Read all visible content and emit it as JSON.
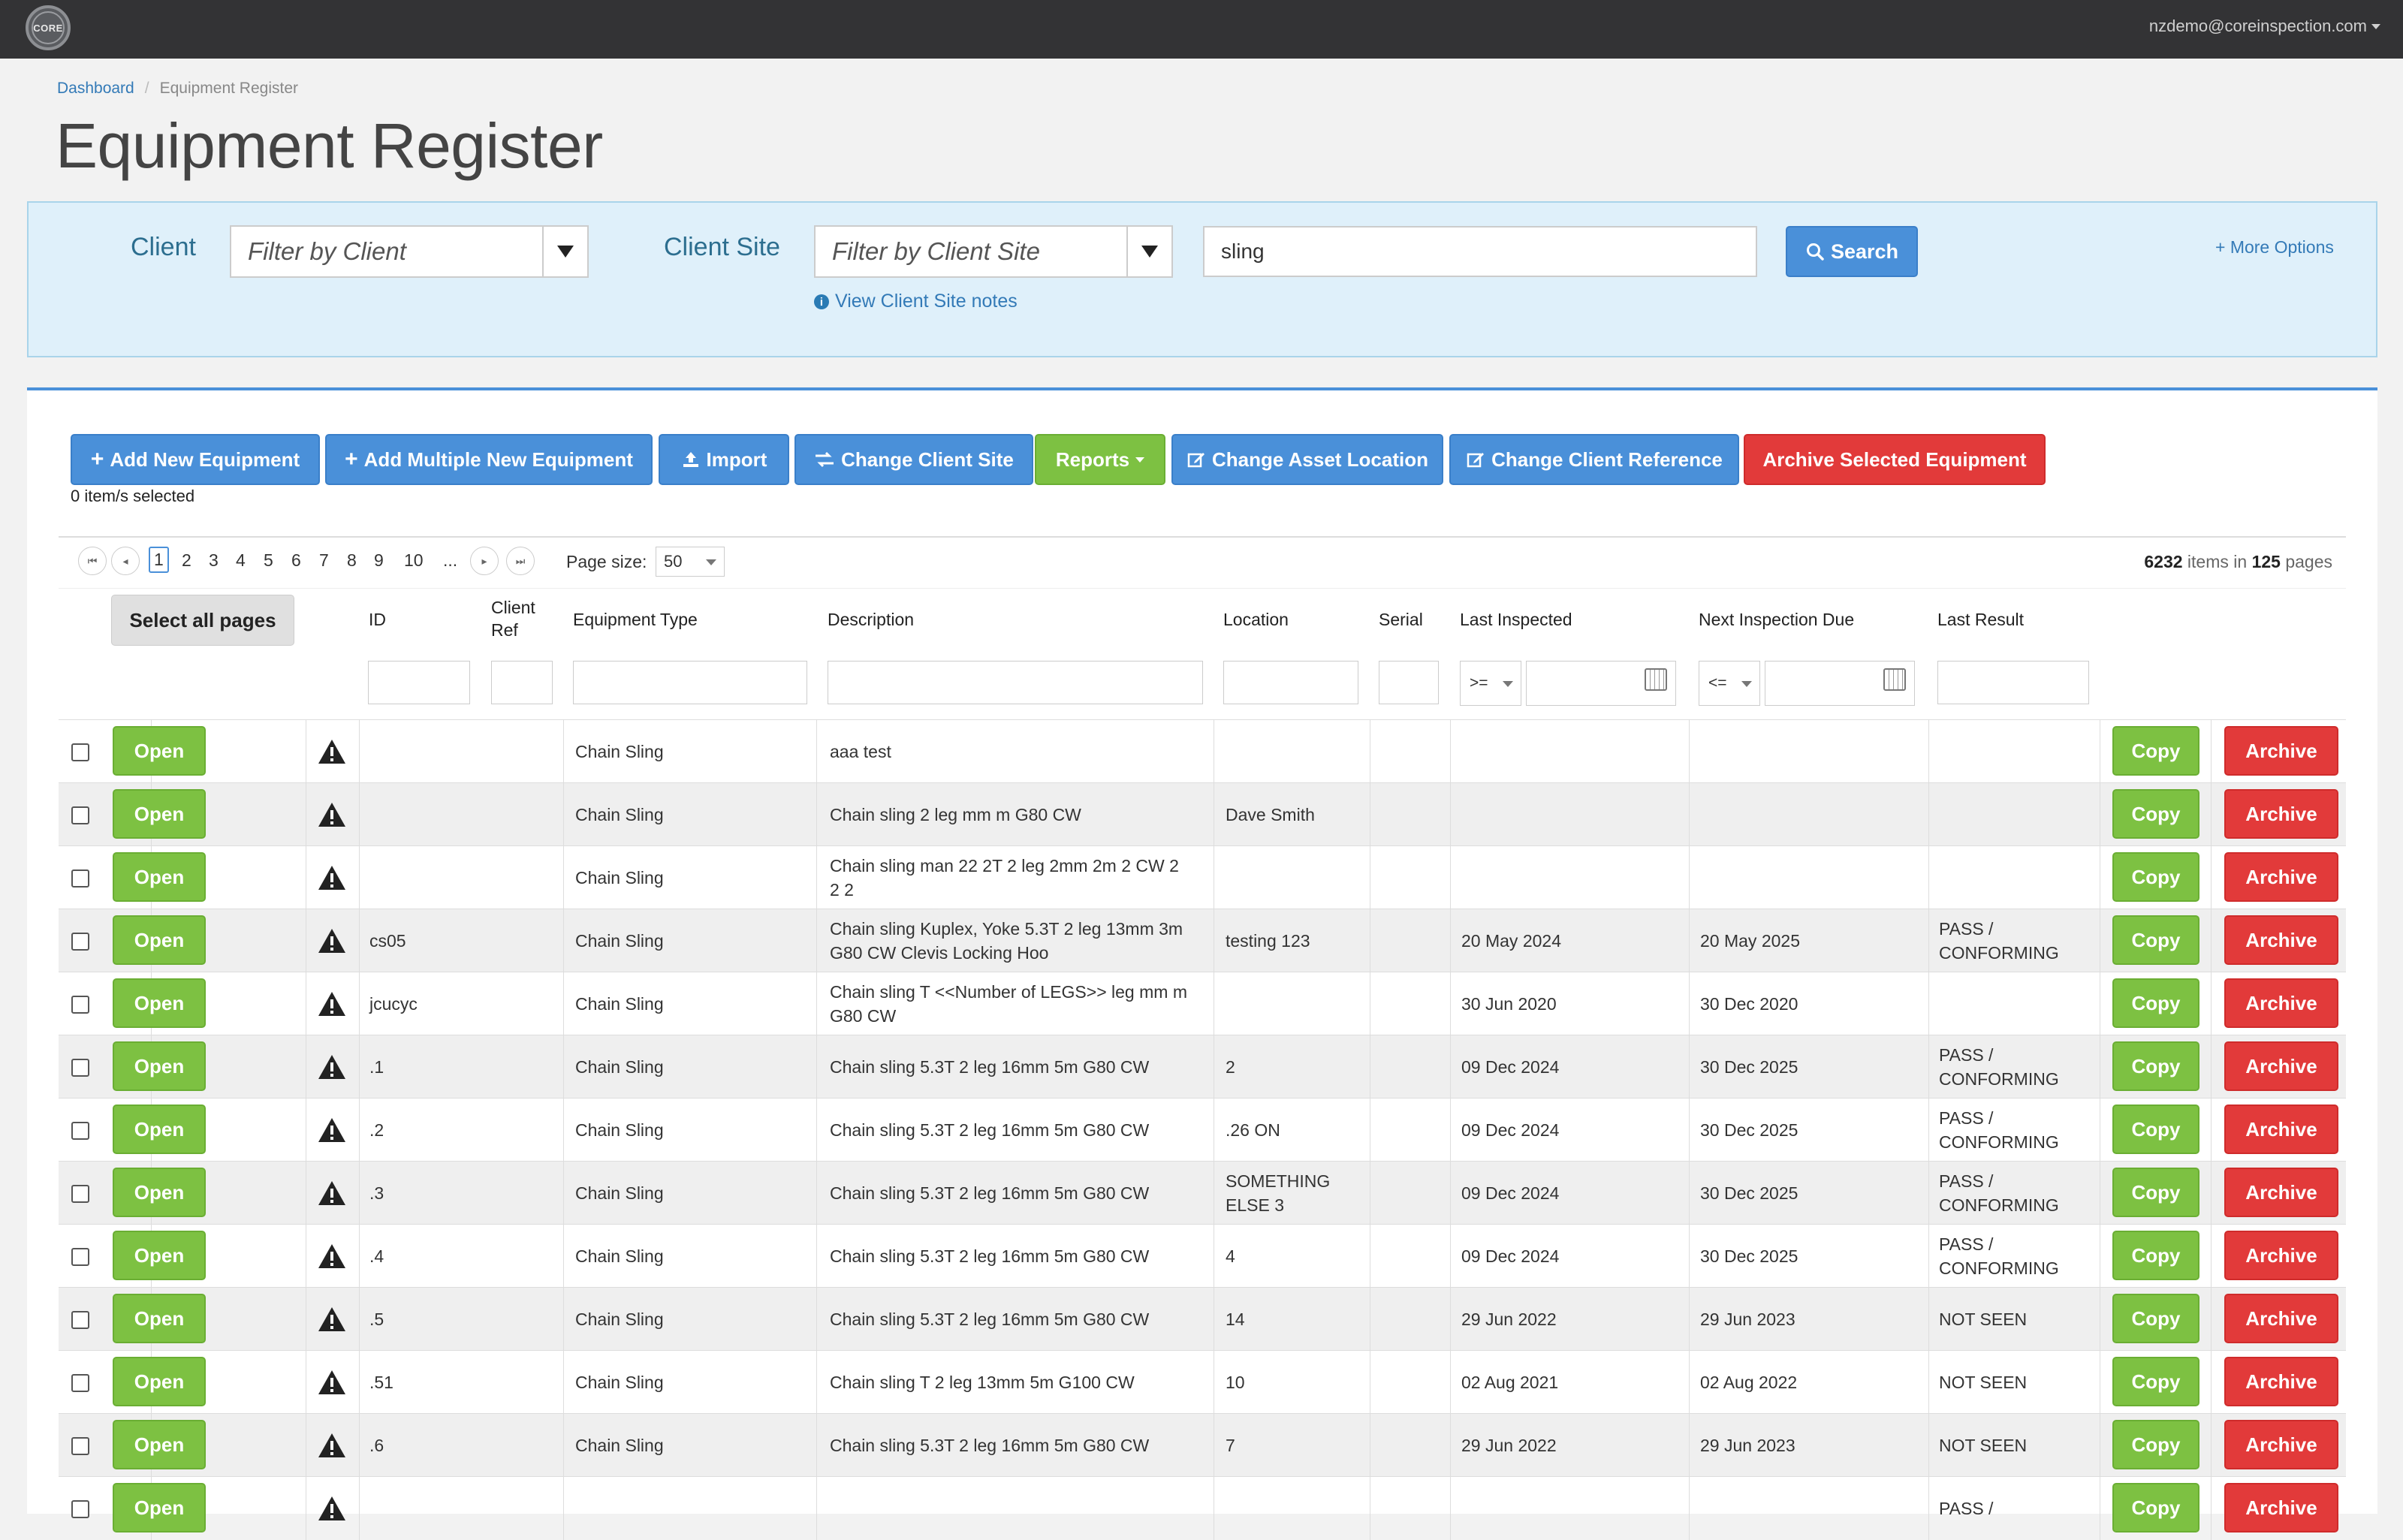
{
  "navbar": {
    "logo_text": "CORE",
    "user_email": "nzdemo@coreinspection.com"
  },
  "breadcrumb": {
    "home": "Dashboard",
    "current": "Equipment Register"
  },
  "page_title": "Equipment Register",
  "filters": {
    "client_label": "Client",
    "client_placeholder": "Filter by Client",
    "site_label": "Client Site",
    "site_placeholder": "Filter by Client Site",
    "search_value": "sling",
    "search_button": "Search",
    "view_notes": "View Client Site notes",
    "more_options": "+ More Options"
  },
  "toolbar": {
    "add_new": "Add New Equipment",
    "add_multiple": "Add Multiple New Equipment",
    "import": "Import",
    "change_site": "Change Client Site",
    "reports": "Reports",
    "change_location": "Change Asset Location",
    "change_reference": "Change Client Reference",
    "archive_selected": "Archive Selected Equipment",
    "selected_count": "0 item/s selected"
  },
  "pager": {
    "pages": [
      "1",
      "2",
      "3",
      "4",
      "5",
      "6",
      "7",
      "8",
      "9",
      "10",
      "..."
    ],
    "active_page": "1",
    "page_size_label": "Page size:",
    "page_size": "50",
    "items_total": "6232",
    "items_in": "items in",
    "page_total": "125",
    "pages_label": "pages"
  },
  "table": {
    "select_all": "Select all pages",
    "columns": {
      "id": "ID",
      "client_ref_1": "Client",
      "client_ref_2": "Ref",
      "equipment_type": "Equipment Type",
      "description": "Description",
      "location": "Location",
      "serial": "Serial",
      "last_inspected": "Last Inspected",
      "next_due": "Next Inspection Due",
      "last_result": "Last Result"
    },
    "last_inspected_op": ">=",
    "next_due_op": "<=",
    "open_label": "Open",
    "copy_label": "Copy",
    "archive_label": "Archive",
    "rows": [
      {
        "id": "",
        "type": "Chain Sling",
        "desc": "aaa test",
        "location": "",
        "last": "",
        "next": "",
        "result": ""
      },
      {
        "id": "",
        "type": "Chain Sling",
        "desc": "Chain sling 2 leg mm m G80 CW",
        "location": "Dave Smith",
        "last": "",
        "next": "",
        "result": ""
      },
      {
        "id": "",
        "type": "Chain Sling",
        "desc": "Chain sling man 22 2T 2 leg 2mm 2m 2 CW 2\n2 2",
        "location": "",
        "last": "",
        "next": "",
        "result": ""
      },
      {
        "id": "cs05",
        "type": "Chain Sling",
        "desc": "Chain sling Kuplex, Yoke 5.3T 2 leg 13mm 3m\nG80 CW Clevis Locking Hoo",
        "location": "testing 123",
        "last": "20 May 2024",
        "next": "20 May 2025",
        "result": "PASS /\nCONFORMING"
      },
      {
        "id": "jcucyc",
        "type": "Chain Sling",
        "desc": "Chain sling T <<Number of LEGS>> leg mm m\nG80 CW",
        "location": "",
        "last": "30 Jun 2020",
        "next": "30 Dec 2020",
        "result": ""
      },
      {
        "id": ".1",
        "type": "Chain Sling",
        "desc": "Chain sling 5.3T 2 leg 16mm 5m G80 CW",
        "location": "2",
        "last": "09 Dec 2024",
        "next": "30 Dec 2025",
        "result": "PASS /\nCONFORMING"
      },
      {
        "id": ".2",
        "type": "Chain Sling",
        "desc": "Chain sling 5.3T 2 leg 16mm 5m G80 CW",
        "location": ".26 ON",
        "last": "09 Dec 2024",
        "next": "30 Dec 2025",
        "result": "PASS /\nCONFORMING"
      },
      {
        "id": ".3",
        "type": "Chain Sling",
        "desc": "Chain sling 5.3T 2 leg 16mm 5m G80 CW",
        "location": "SOMETHING\nELSE 3",
        "last": "09 Dec 2024",
        "next": "30 Dec 2025",
        "result": "PASS /\nCONFORMING"
      },
      {
        "id": ".4",
        "type": "Chain Sling",
        "desc": "Chain sling 5.3T 2 leg 16mm 5m G80 CW",
        "location": "4",
        "last": "09 Dec 2024",
        "next": "30 Dec 2025",
        "result": "PASS /\nCONFORMING"
      },
      {
        "id": ".5",
        "type": "Chain Sling",
        "desc": "Chain sling 5.3T 2 leg 16mm 5m G80 CW",
        "location": "14",
        "last": "29 Jun 2022",
        "next": "29 Jun 2023",
        "result": "NOT SEEN"
      },
      {
        "id": ".51",
        "type": "Chain Sling",
        "desc": "Chain sling T 2 leg 13mm 5m G100 CW",
        "location": "10",
        "last": "02 Aug 2021",
        "next": "02 Aug 2022",
        "result": "NOT SEEN"
      },
      {
        "id": ".6",
        "type": "Chain Sling",
        "desc": "Chain sling 5.3T 2 leg 16mm 5m G80 CW",
        "location": "7",
        "last": "29 Jun 2022",
        "next": "29 Jun 2023",
        "result": "NOT SEEN"
      },
      {
        "id": "",
        "type": "",
        "desc": "",
        "location": "",
        "last": "",
        "next": "",
        "result": "PASS /"
      }
    ]
  }
}
